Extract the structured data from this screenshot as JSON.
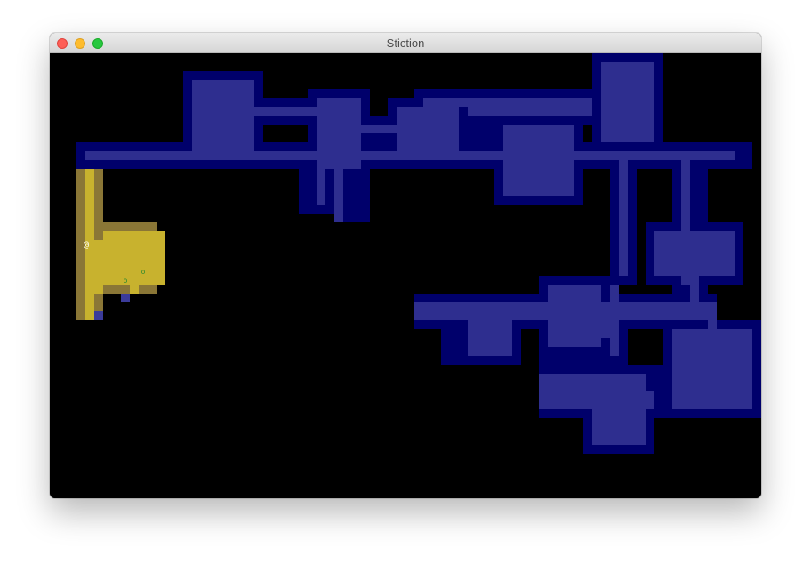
{
  "window": {
    "title": "Stiction",
    "controls": [
      "close-button",
      "minimize-button",
      "zoom-button"
    ]
  },
  "game": {
    "type": "roguelike dungeon map",
    "player_glyph": "@",
    "item_glyph": "o",
    "colors": {
      "background": "#000000",
      "explored_wall": "#00006b",
      "explored_floor": "#2e2e8f",
      "lit_floor": "#c8b22e",
      "lit_wall": "#8a7636",
      "player": "#ffffff",
      "item": "#2e8b2e",
      "stair_marker": "#3b3b9a"
    }
  }
}
